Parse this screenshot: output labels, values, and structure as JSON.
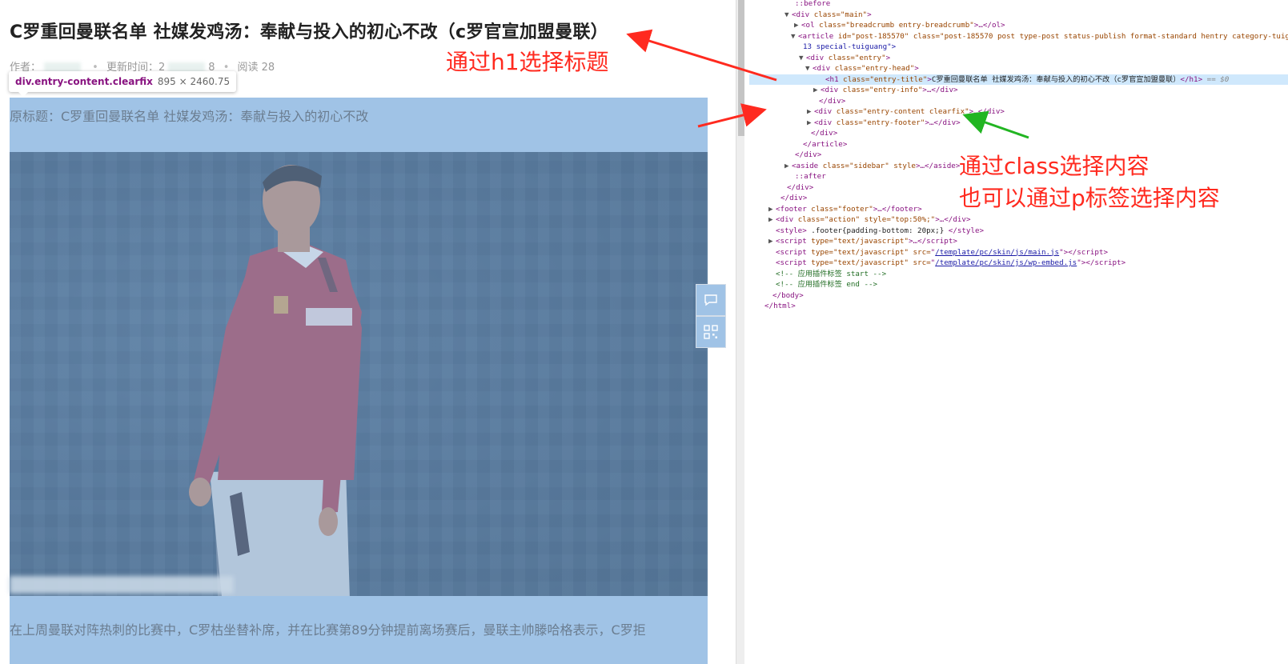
{
  "article": {
    "title": "C罗重回曼联名单 社媒发鸡汤：奉献与投入的初心不改（c罗官宣加盟曼联）",
    "meta_author_label": "作者：",
    "meta_update_label": "更新时间：",
    "meta_update_value_start": "2",
    "meta_update_value_end": "8",
    "meta_reads": "阅读 28",
    "original_title": "原标题：C罗重回曼联名单 社媒发鸡汤：奉献与投入的初心不改",
    "paragraph": "在上周曼联对阵热刺的比赛中，C罗枯坐替补席，并在比赛第89分钟提前离场赛后，曼联主帅滕哈格表示，C罗拒"
  },
  "inspector_tooltip": {
    "selector": "div.entry-content.clearfix",
    "dimensions": "895 × 2460.75"
  },
  "float_buttons": [
    {
      "icon": "comment-icon"
    },
    {
      "icon": "qrcode-icon"
    }
  ],
  "devtools": {
    "ellipsis": "···",
    "lines": [
      {
        "tri": "",
        "html": "::before",
        "type": "pseudo"
      },
      {
        "tri": "▼",
        "tag": "div",
        "attrs": "class=\"main\""
      },
      {
        "tri": "▶",
        "tag": "ol",
        "attrs": "class=\"breadcrumb entry-breadcrumb\"",
        "collapsed": "ol"
      },
      {
        "tri": "▼",
        "tag": "article",
        "attrs": "id=\"post-185570\" class=\"post-185570 post type-post status-publish format-standard hentry category-tuigu"
      },
      {
        "tri": "",
        "cont": "13 special-tuiguang\">"
      },
      {
        "tri": "▼",
        "tag": "div",
        "attrs": "class=\"entry\""
      },
      {
        "tri": "▼",
        "tag": "div",
        "attrs": "class=\"entry-head\""
      },
      {
        "tri": "",
        "tag": "h1",
        "attrs": "class=\"entry-title\"",
        "text": "C罗重回曼联名单 社媒发鸡汤：奉献与投入的初心不改（c罗官宣加盟曼联）",
        "close": "h1",
        "selected": true,
        "dollar": "== $0"
      },
      {
        "tri": "▶",
        "tag": "div",
        "attrs": "class=\"entry-info\"",
        "collapsed": "div"
      },
      {
        "tri": "",
        "closeonly": "div"
      },
      {
        "tri": "▶",
        "tag": "div",
        "attrs": "class=\"entry-content clearfix\"",
        "collapsed": "div",
        "hover": true
      },
      {
        "tri": "▶",
        "tag": "div",
        "attrs": "class=\"entry-footer\"",
        "collapsed": "div"
      },
      {
        "tri": "",
        "closeonly": "div"
      },
      {
        "tri": "",
        "closeonly": "article"
      },
      {
        "tri": "",
        "closeonly": "div"
      },
      {
        "tri": "▶",
        "tag": "aside",
        "attrs": "class=\"sidebar\" style",
        "collapsed": "aside"
      },
      {
        "tri": "",
        "html": "::after",
        "type": "pseudo"
      },
      {
        "tri": "",
        "closeonly": "div"
      },
      {
        "tri": "",
        "closeonly": "div"
      },
      {
        "tri": "▶",
        "tag": "footer",
        "attrs": "class=\"footer\"",
        "collapsed": "footer"
      },
      {
        "tri": "▶",
        "tag": "div",
        "attrs": "class=\"action\" style=\"top:50%;\"",
        "collapsed": "div"
      },
      {
        "tri": "",
        "tag": "style",
        "text": " .footer{padding-bottom: 20px;} ",
        "close": "style"
      },
      {
        "tri": "▶",
        "tag": "script",
        "attrs": "type=\"text/javascript\"",
        "collapsed": "script"
      },
      {
        "tri": "",
        "tag": "script",
        "attrs": "type=\"text/javascript\" src=",
        "link": "/template/pc/skin/js/main.js",
        "close": "script"
      },
      {
        "tri": "",
        "tag": "script",
        "attrs": "type=\"text/javascript\" src=",
        "link": "/template/pc/skin/js/wp-embed.js",
        "close": "script"
      },
      {
        "tri": "",
        "comment": "<!-- 应用插件标签 start -->"
      },
      {
        "tri": "",
        "comment": "<!-- 应用插件标签 end -->"
      },
      {
        "tri": "",
        "closeonly": "body"
      },
      {
        "tri": "",
        "closeonly": "html"
      }
    ]
  },
  "annotations": {
    "title_note": "通过h1选择标题",
    "class_note": "通过class选择内容",
    "p_note": "也可以通过p标签选择内容"
  },
  "colors": {
    "annotation_red": "#ff2a1f",
    "annotation_green": "#22b522",
    "highlight_blue": "#a0c3e6",
    "selected_row": "#cfe8fc"
  }
}
